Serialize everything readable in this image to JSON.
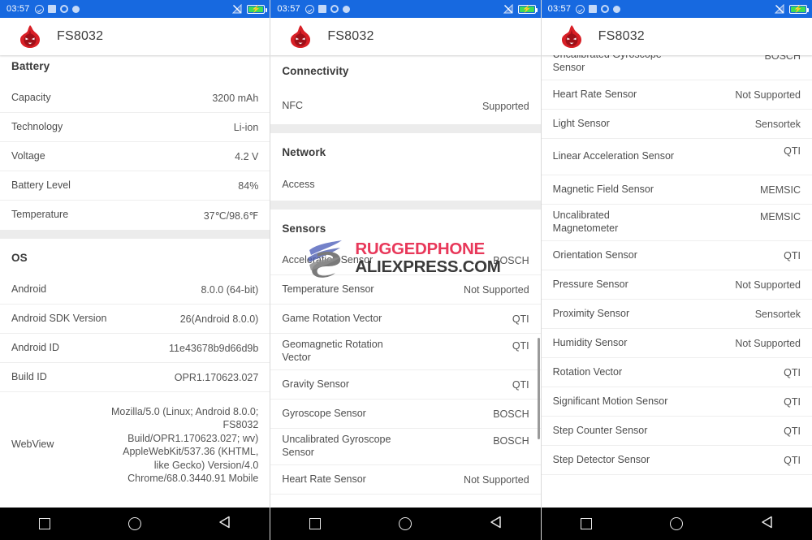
{
  "statusbar": {
    "time": "03:57",
    "left_icons": [
      "check-circle-icon",
      "square-icon",
      "ring-icon",
      "dot-icon"
    ],
    "right_icons": [
      "no-signal-icon",
      "battery-charging-icon"
    ],
    "battery_color": "#3ddc57",
    "bar_color": "#1769e0"
  },
  "appbar": {
    "title": "FS8032",
    "icon": "antutu-flame-icon"
  },
  "navbar": {
    "recents": "square-recents-icon",
    "home": "circle-home-icon",
    "back": "triangle-back-icon"
  },
  "watermark": {
    "line1": "RUGGEDPHONE",
    "line2": "ALIEXPRESS.COM",
    "line1_color": "#e8385a",
    "line2_color": "#3a3a3a"
  },
  "panel1": {
    "sections": [
      {
        "title": "Battery",
        "rows": [
          {
            "key": "Capacity",
            "value": "3200 mAh"
          },
          {
            "key": "Technology",
            "value": "Li-ion"
          },
          {
            "key": "Voltage",
            "value": "4.2 V"
          },
          {
            "key": "Battery Level",
            "value": "84%"
          },
          {
            "key": "Temperature",
            "value": "37℃/98.6℉"
          }
        ]
      },
      {
        "title": "OS",
        "rows": [
          {
            "key": "Android",
            "value": "8.0.0 (64-bit)"
          },
          {
            "key": "Android SDK Version",
            "value": "26(Android 8.0.0)"
          },
          {
            "key": "Android ID",
            "value": "11e43678b9d66d9b"
          },
          {
            "key": "Build ID",
            "value": "OPR1.170623.027"
          },
          {
            "key": "WebView",
            "value": "Mozilla/5.0 (Linux; Android 8.0.0; FS8032 Build/OPR1.170623.027; wv) AppleWebKit/537.36 (KHTML, like Gecko) Version/4.0 Chrome/68.0.3440.91 Mobile"
          }
        ]
      }
    ]
  },
  "panel2": {
    "sections": [
      {
        "title": "Connectivity",
        "rows": [
          {
            "key": "NFC",
            "value": "Supported"
          }
        ]
      },
      {
        "title": "Network",
        "rows": [
          {
            "key": "Access",
            "value": ""
          }
        ]
      },
      {
        "title": "Sensors",
        "rows": [
          {
            "key": "Acceleration Sensor",
            "value": "BOSCH"
          },
          {
            "key": "Temperature Sensor",
            "value": "Not Supported"
          },
          {
            "key": "Game Rotation Vector",
            "value": "QTI"
          },
          {
            "key": "Geomagnetic Rotation Vector",
            "value": "QTI"
          },
          {
            "key": "Gravity Sensor",
            "value": "QTI"
          },
          {
            "key": "Gyroscope Sensor",
            "value": "BOSCH"
          },
          {
            "key": "Uncalibrated Gyroscope Sensor",
            "value": "BOSCH"
          },
          {
            "key": "Heart Rate Sensor",
            "value": "Not Supported"
          }
        ]
      }
    ]
  },
  "panel3": {
    "rows": [
      {
        "key": "Uncalibrated Gyroscope Sensor",
        "value": "BOSCH"
      },
      {
        "key": "Heart Rate Sensor",
        "value": "Not Supported"
      },
      {
        "key": "Light Sensor",
        "value": "Sensortek"
      },
      {
        "key": "Linear Acceleration Sensor",
        "value": "QTI"
      },
      {
        "key": "Magnetic Field Sensor",
        "value": "MEMSIC"
      },
      {
        "key": "Uncalibrated Magnetometer",
        "value": "MEMSIC"
      },
      {
        "key": "Orientation Sensor",
        "value": "QTI"
      },
      {
        "key": "Pressure Sensor",
        "value": "Not Supported"
      },
      {
        "key": "Proximity Sensor",
        "value": "Sensortek"
      },
      {
        "key": "Humidity Sensor",
        "value": "Not Supported"
      },
      {
        "key": "Rotation Vector",
        "value": "QTI"
      },
      {
        "key": "Significant Motion Sensor",
        "value": "QTI"
      },
      {
        "key": "Step Counter Sensor",
        "value": "QTI"
      },
      {
        "key": "Step Detector Sensor",
        "value": "QTI"
      }
    ]
  }
}
